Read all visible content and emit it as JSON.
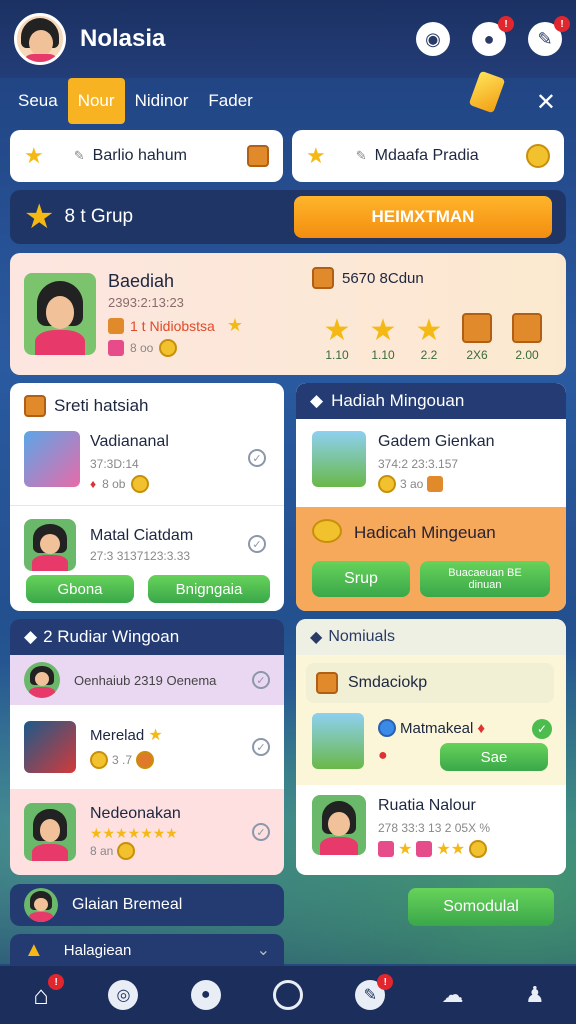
{
  "header": {
    "title": "Nolasia"
  },
  "tabs": [
    "Seua",
    "Nour",
    "Nidinor",
    "Fader"
  ],
  "quick": [
    {
      "label": "Barlio hahum"
    },
    {
      "label": "Mdaafa Pradia"
    }
  ],
  "group": {
    "label": "8 t Grup",
    "button": "HEIMXTMAN"
  },
  "profile": {
    "name": "Baediah",
    "line1": "2393:2:13:23",
    "line2": "1 t Nidiobstsa",
    "line3": "8 oo",
    "counts": [
      "1.10",
      "1.10",
      "2.2",
      "2X6",
      "2.00"
    ]
  },
  "secret": {
    "title": "Sreti hatsiah",
    "items": [
      {
        "title": "Vadiananal",
        "sub": "37:3D:14",
        "tag": "8 ob"
      },
      {
        "title": "Matal Ciatdam",
        "sub": "27:3 3137123:3.33"
      }
    ],
    "btn1": "Gbona",
    "btn2": "Bnigngaia"
  },
  "weekly": {
    "title": "Hadiah Mingouan",
    "item": {
      "title": "Gadem Gienkan",
      "sub": "374:2 23:3.157",
      "tag": "3 ao"
    },
    "banner": "Hadicah Mingeuan",
    "btn1": "Srup",
    "btn2": "Buacaeuan BE\ndinuan"
  },
  "rank": {
    "title": "2 Rudiar Wingoan",
    "rows": [
      {
        "title": "Oenhaiub 2319 Oenema"
      },
      {
        "title": "Merelad",
        "sub": "3 .7"
      },
      {
        "title": "Nedeonakan",
        "sub": "8 an"
      }
    ]
  },
  "normal": {
    "title": "Nomiuals",
    "rows": [
      {
        "title": "Smdaciokp"
      },
      {
        "title": "Matmakeal",
        "btn": "Sae"
      },
      {
        "title": "Ruatia Nalour",
        "sub": "278 33:3 13 2 05X %"
      }
    ]
  },
  "bottom": {
    "left": "Glaian Bremeal",
    "btn": "Somodulal",
    "last": "Halagiean"
  },
  "colors": {
    "accent": "#f7b321",
    "green": "#4cbc4f",
    "navy": "#1c2f5c"
  }
}
